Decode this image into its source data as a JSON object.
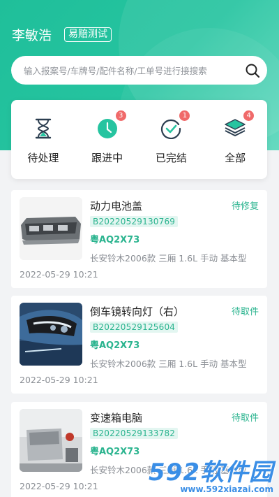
{
  "header": {
    "user_name": "李敏浩",
    "user_tag": "易赔测试",
    "search_placeholder": "输入报案号/车牌号/配件名称/工单号进行接搜索",
    "accent_color": "#26c4a0"
  },
  "stats": [
    {
      "label": "待处理",
      "icon": "hourglass-icon",
      "badge": ""
    },
    {
      "label": "跟进中",
      "icon": "clock-icon",
      "badge": "3"
    },
    {
      "label": "已完结",
      "icon": "check-circle-icon",
      "badge": "1"
    },
    {
      "label": "全部",
      "icon": "stack-icon",
      "badge": "4"
    }
  ],
  "orders": [
    {
      "title": "动力电池盖",
      "status": "待修复",
      "code": "B20220529130769",
      "plate": "粤AQ2X73",
      "model": "长安铃木2006款 三厢 1.6L 手动 基本型",
      "time": "2022-05-29 10:21"
    },
    {
      "title": "倒车镜转向灯（右）",
      "status": "待取件",
      "code": "B20220529125604",
      "plate": "粤AQ2X73",
      "model": "长安铃木2006款 三厢 1.6L 手动 基本型",
      "time": "2022-05-29 10:21"
    },
    {
      "title": "变速箱电脑",
      "status": "待取件",
      "code": "B20220529133782",
      "plate": "粤AQ2X73",
      "model": "长安铃木2006款 三厢 1.6L 手动 基本型",
      "time": "2022-05-29 10:21"
    }
  ],
  "watermark": {
    "main": "592软件园",
    "sub": "www.592xiazai.com"
  }
}
